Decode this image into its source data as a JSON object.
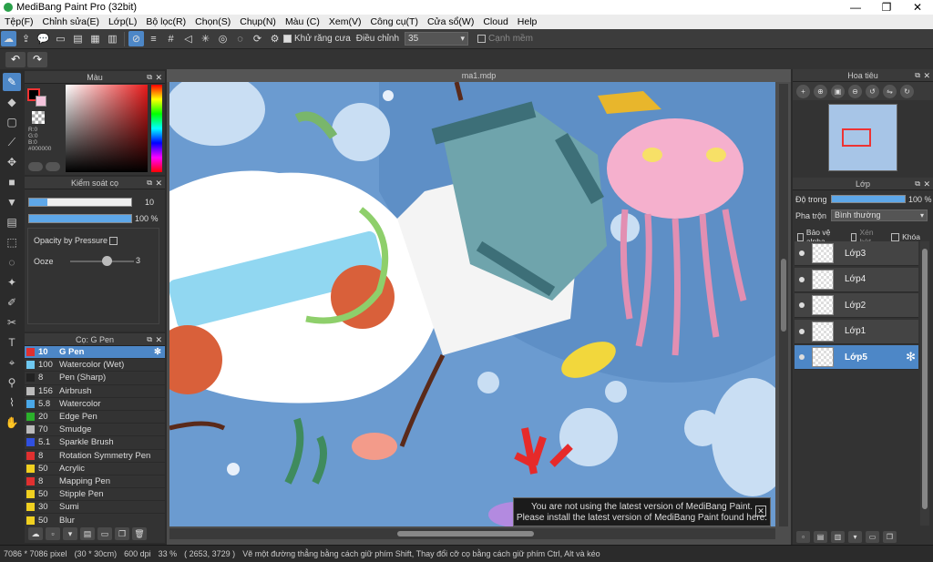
{
  "window": {
    "title": "MediBang Paint Pro (32bit)",
    "min": "—",
    "max": "❐",
    "close": "✕"
  },
  "menu": [
    "Tệp(F)",
    "Chỉnh sửa(E)",
    "Lớp(L)",
    "Bộ lọc(R)",
    "Chọn(S)",
    "Chụp(N)",
    "Màu (C)",
    "Xem(V)",
    "Công cụ(T)",
    "Cửa sổ(W)",
    "Cloud",
    "Help"
  ],
  "toolbar": {
    "antialias_label": "Khử răng cưa",
    "adjust_label": "Điều chỉnh",
    "adjust_value": "35",
    "snap_label": "Cạnh mềm"
  },
  "color_panel": {
    "title": "Màu",
    "r": "R:0",
    "g": "G:0",
    "b": "B:0",
    "hex": "#000000"
  },
  "brush_panel": {
    "title": "Kiểm soát cọ",
    "size_value": "10",
    "size_fraction": 0.18,
    "opacity_value": "100 %",
    "opacity_fraction": 1.0,
    "pressure_label": "Opacity by Pressure",
    "ooze_label": "Ooze",
    "ooze_value": "3"
  },
  "brush_list": {
    "title": "Cọ: G Pen",
    "items": [
      {
        "size": "10",
        "name": "G Pen",
        "color": "#e03030",
        "selected": true
      },
      {
        "size": "100",
        "name": "Watercolor (Wet)",
        "color": "#6ec8f0"
      },
      {
        "size": "8",
        "name": "Pen (Sharp)",
        "color": "#222222"
      },
      {
        "size": "156",
        "name": "Airbrush",
        "color": "#bbbbbb"
      },
      {
        "size": "5.8",
        "name": "Watercolor",
        "color": "#4aa8e8"
      },
      {
        "size": "20",
        "name": "Edge Pen",
        "color": "#2bb02b"
      },
      {
        "size": "70",
        "name": "Smudge",
        "color": "#bbbbbb"
      },
      {
        "size": "5.1",
        "name": "Sparkle Brush",
        "color": "#3050e0"
      },
      {
        "size": "8",
        "name": "Rotation Symmetry Pen",
        "color": "#e03030"
      },
      {
        "size": "50",
        "name": "Acrylic",
        "color": "#f0d020"
      },
      {
        "size": "8",
        "name": "Mapping Pen",
        "color": "#e03030"
      },
      {
        "size": "50",
        "name": "Stipple Pen",
        "color": "#f0d020"
      },
      {
        "size": "30",
        "name": "Sumi",
        "color": "#f0d020"
      },
      {
        "size": "50",
        "name": "Blur",
        "color": "#f0d020"
      }
    ]
  },
  "canvas": {
    "tab": "ma1.mdp"
  },
  "notification": {
    "line1": "You are not using the latest version of MediBang Paint.",
    "line2": "Please install the latest version of MediBang Paint found here."
  },
  "navigator": {
    "title": "Hoa tiêu"
  },
  "layers": {
    "title": "Lớp",
    "opacity_label": "Độ trong",
    "opacity_value": "100 %",
    "blend_label": "Pha trộn",
    "blend_value": "Bình thường",
    "protect_alpha": "Bảo vệ alpha",
    "clipping": "Xén bớt",
    "lock": "Khóa",
    "items": [
      {
        "name": "Lớp3",
        "selected": false
      },
      {
        "name": "Lớp4",
        "selected": false
      },
      {
        "name": "Lớp2",
        "selected": false
      },
      {
        "name": "Lớp1",
        "selected": false
      },
      {
        "name": "Lớp5",
        "selected": true
      }
    ]
  },
  "status": {
    "size": "7086 * 7086 pixel",
    "cm": "(30 * 30cm)",
    "dpi": "600 dpi",
    "zoom": "33 %",
    "coords": "( 2653, 3729 )",
    "hint": "Vẽ một đường thẳng bằng cách giữ phím Shift, Thay đổi cỡ cọ bằng cách giữ phím Ctrl, Alt và kéo"
  }
}
